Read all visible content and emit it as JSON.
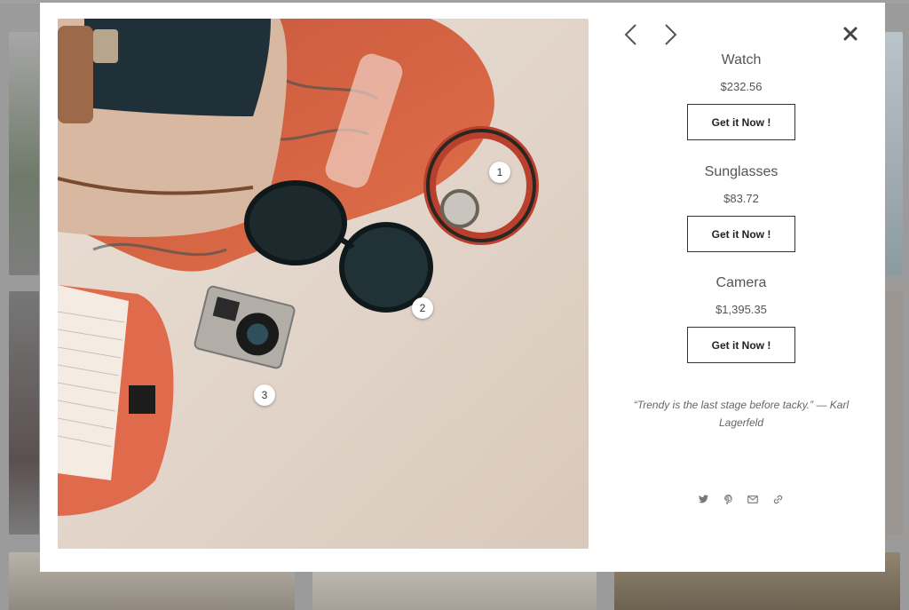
{
  "products": [
    {
      "name": "Watch",
      "price": "$232.56",
      "cta": "Get it Now !"
    },
    {
      "name": "Sunglasses",
      "price": "$83.72",
      "cta": "Get it Now !"
    },
    {
      "name": "Camera",
      "price": "$1,395.35",
      "cta": "Get it Now !"
    }
  ],
  "hotspots": [
    "1",
    "2",
    "3"
  ],
  "quote": "“Trendy is the last stage before tacky.” — Karl Lagerfeld",
  "icons": {
    "prev": "chevron-left-icon",
    "next": "chevron-right-icon",
    "close": "close-icon",
    "share": [
      "twitter-icon",
      "pinterest-icon",
      "email-icon",
      "link-icon"
    ]
  },
  "colors": {
    "modal_bg": "#ffffff",
    "overlay": "#8a8a8a",
    "text": "#555555",
    "button_border": "#333333"
  }
}
